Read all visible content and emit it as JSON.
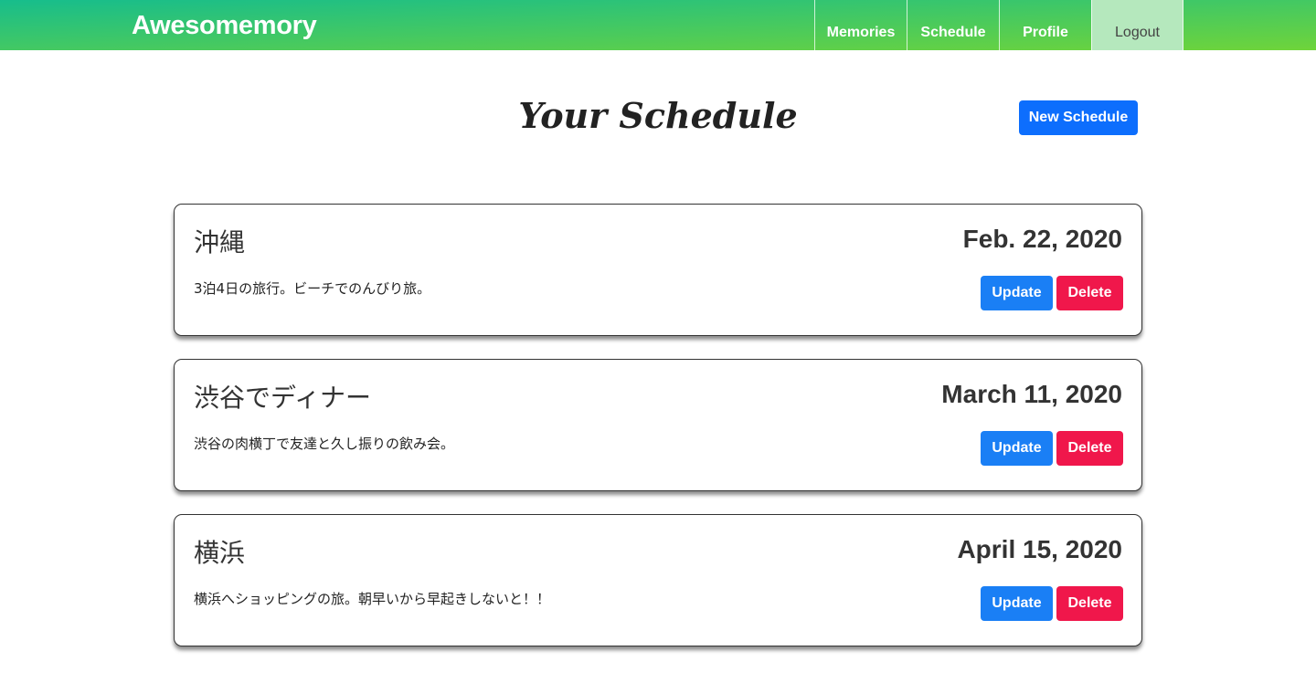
{
  "brand": "Awesomemory",
  "nav": {
    "memories": "Memories",
    "schedule": "Schedule",
    "profile": "Profile",
    "logout": "Logout"
  },
  "page_title": "Your Schedule",
  "new_schedule_label": "New Schedule",
  "colors": {
    "navbar_gradient_start": "#17bd8c",
    "navbar_gradient_end": "#6fd43a",
    "logout_bg": "#b5e8bd",
    "primary": "#0d6efd",
    "update": "#1a7ff5",
    "delete": "#f0174b"
  },
  "schedules": [
    {
      "title": "沖縄",
      "date": "Feb. 22, 2020",
      "description": "3泊4日の旅行。ビーチでのんびり旅。",
      "update_label": "Update",
      "delete_label": "Delete"
    },
    {
      "title": "渋谷でディナー",
      "date": "March 11, 2020",
      "description": "渋谷の肉横丁で友達と久し振りの飲み会。",
      "update_label": "Update",
      "delete_label": "Delete"
    },
    {
      "title": "横浜",
      "date": "April 15, 2020",
      "description": "横浜へショッピングの旅。朝早いから早起きしないと！！",
      "update_label": "Update",
      "delete_label": "Delete"
    }
  ]
}
